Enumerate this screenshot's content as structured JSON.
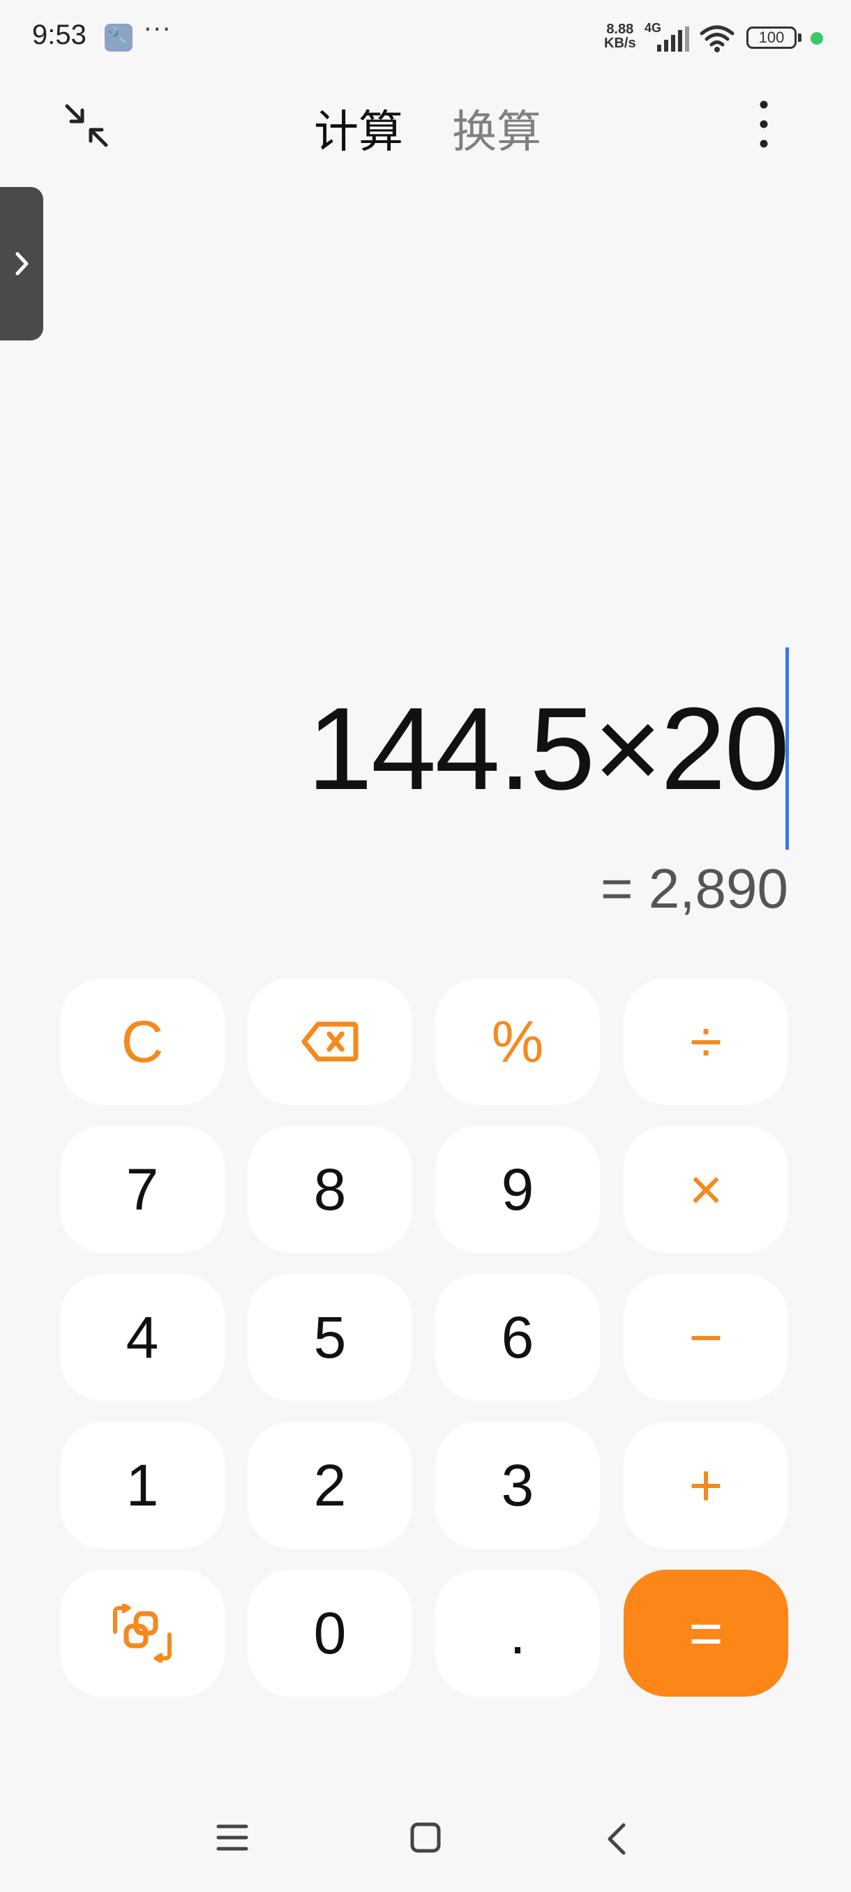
{
  "status_bar": {
    "time": "9:53",
    "dots": "···",
    "speed_value": "8.88",
    "speed_unit": "KB/s",
    "network": "4G",
    "battery": "100"
  },
  "header": {
    "tabs": [
      {
        "label": "计算",
        "active": true
      },
      {
        "label": "换算",
        "active": false
      }
    ]
  },
  "display": {
    "expression": "144.5×20",
    "result": "= 2,890"
  },
  "keypad": {
    "clear": "C",
    "percent": "%",
    "divide": "÷",
    "multiply": "×",
    "minus": "−",
    "plus": "+",
    "equals": "=",
    "dot": ".",
    "digits": {
      "0": "0",
      "1": "1",
      "2": "2",
      "3": "3",
      "4": "4",
      "5": "5",
      "6": "6",
      "7": "7",
      "8": "8",
      "9": "9"
    }
  },
  "colors": {
    "accent": "#fd8619",
    "background": "#f7f7f7",
    "key_bg": "#ffffff",
    "cursor": "#3b78e7"
  },
  "icons": [
    "collapse-icon",
    "more-vertical-icon",
    "chevron-right-icon",
    "backspace-icon",
    "switch-mode-icon",
    "nav-menu-icon",
    "nav-home-icon",
    "nav-back-icon",
    "signal-icon",
    "wifi-icon",
    "battery-icon"
  ]
}
